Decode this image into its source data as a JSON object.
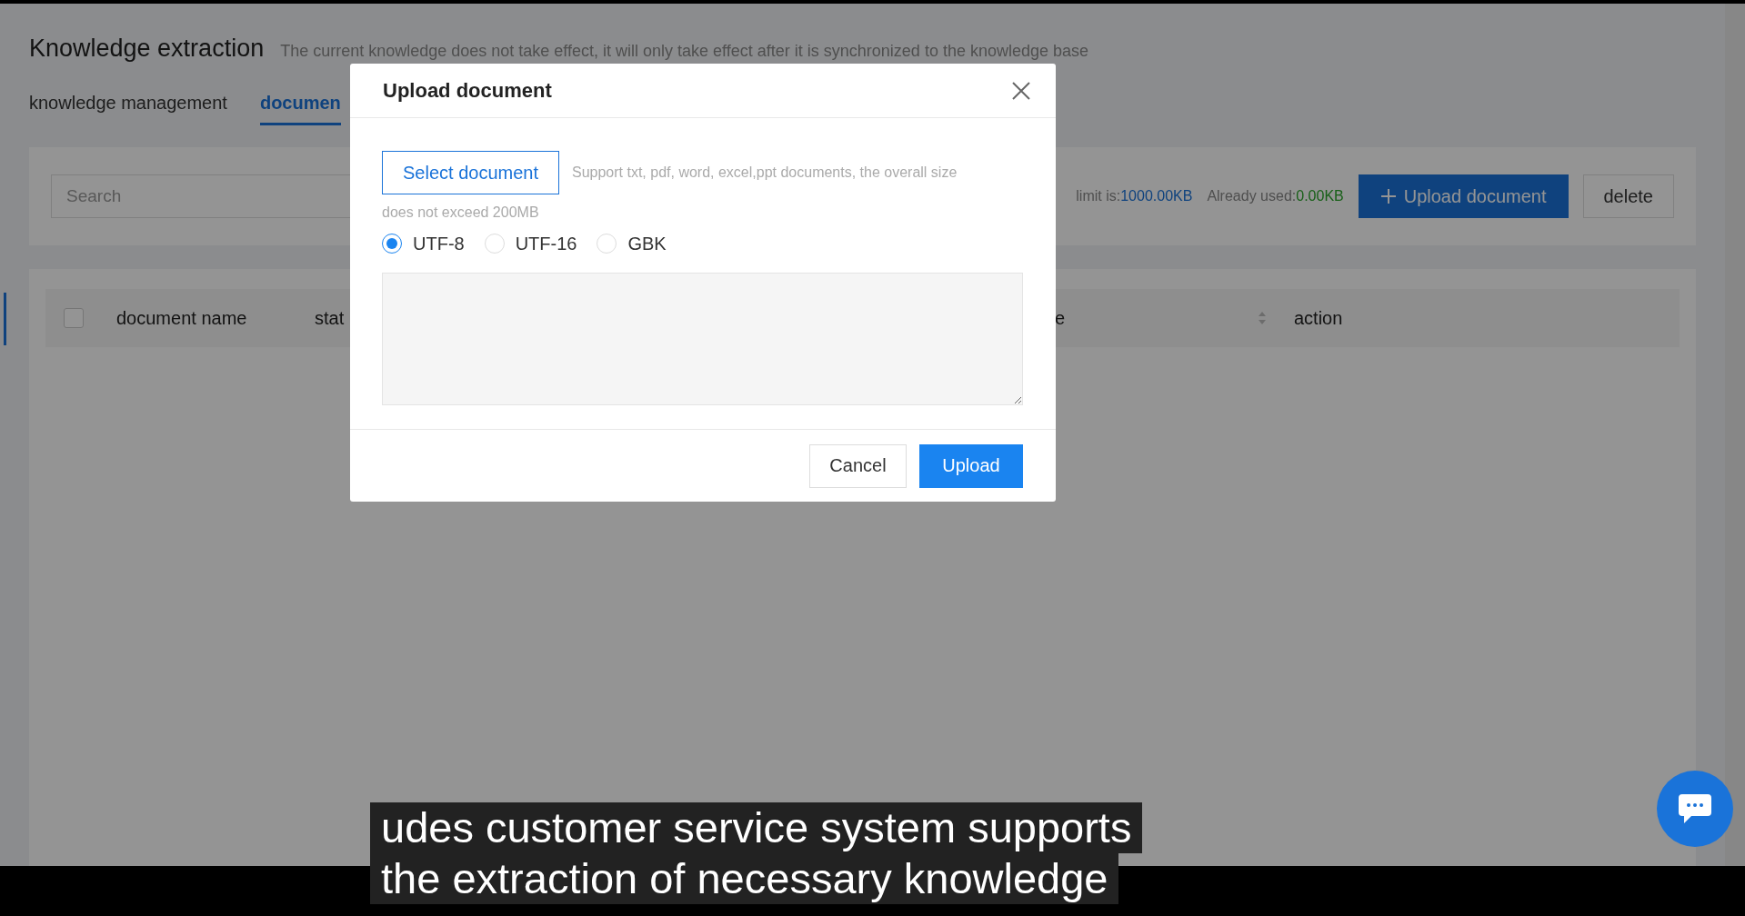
{
  "page": {
    "title": "Knowledge extraction",
    "notice": "The current knowledge does not take effect, it will only take effect after it is synchronized to the knowledge base"
  },
  "tabs": [
    {
      "label": "knowledge management",
      "selected": false
    },
    {
      "label": "documen",
      "selected": true
    }
  ],
  "toolbar": {
    "search_placeholder": "Search",
    "limit_label": "limit is:",
    "limit_value": "1000.00KB",
    "used_label": "Already used:",
    "used_value": "0.00KB",
    "upload_button": "Upload document",
    "delete_button": "delete"
  },
  "table": {
    "select_all_checked": false,
    "columns": [
      {
        "label": "document name",
        "sortable": false
      },
      {
        "label": "stat",
        "sortable": false
      },
      {
        "label": "e",
        "sortable": true
      },
      {
        "label": "action",
        "sortable": false
      }
    ]
  },
  "dialog": {
    "title": "Upload document",
    "select_button": "Select document",
    "hint_lines": [
      "Support txt, pdf, word, excel,ppt documents, the overall size",
      "does not exceed 200MB"
    ],
    "encodings": [
      {
        "label": "UTF-8",
        "selected": true
      },
      {
        "label": "UTF-16",
        "selected": false
      },
      {
        "label": "GBK",
        "selected": false
      }
    ],
    "cancel_button": "Cancel",
    "ok_button": "Upload"
  },
  "subtitles": [
    "udes customer service system supports",
    "the extraction of necessary knowledge"
  ]
}
